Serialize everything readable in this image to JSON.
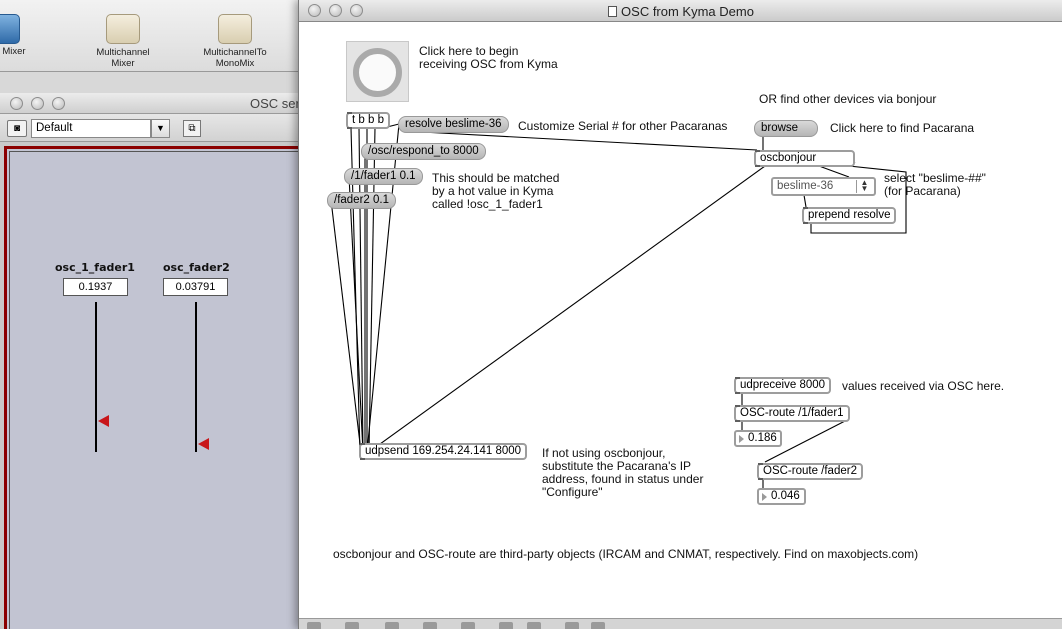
{
  "kyma_toolbar": {
    "items": [
      {
        "label": "Mixer",
        "icon": "mixer-icon"
      },
      {
        "label": "Multichannel\nMixer",
        "icon": "multichannel-mixer-icon"
      },
      {
        "label": "MultichannelTo\nMonoMix",
        "icon": "multichannel-to-mono-icon"
      }
    ]
  },
  "osc_window": {
    "title": "OSC ser",
    "preset": "Default",
    "faders": [
      {
        "label": "osc_1_fader1",
        "value": "0.1937",
        "level": 0.1937
      },
      {
        "label": "osc_fader2",
        "value": "0.03791",
        "level": 0.03791
      }
    ],
    "colors": {
      "frame": "#8b0000",
      "background": "#c2c4d2",
      "thumb": "#c8161a"
    }
  },
  "max_window": {
    "title": "OSC from Kyma Demo",
    "objects": {
      "trigger": "t b b b",
      "resolve_msg": "resolve beslime-36",
      "respond_msg": "/osc/respond_to 8000",
      "fader1_msg": "/1/fader1 0.1",
      "fader2_msg": "/fader2 0.1",
      "browse_msg": "browse",
      "oscbonjour": "oscbonjour",
      "umenu": "beslime-36",
      "prepend": "prepend resolve",
      "udpsend": "udpsend 169.254.24.141 8000",
      "udpreceive": "udpreceive 8000",
      "route1": "OSC-route /1/fader1",
      "num1": "0.186",
      "route2": "OSC-route /fader2",
      "num2": "0.046"
    },
    "comments": {
      "begin": "Click here to begin\nreceiving OSC from Kyma",
      "bonjour": "OR find other devices via bonjour",
      "customize": "Customize Serial # for other Pacaranas",
      "find": "Click here to find Pacarana",
      "select": "select \"beslime-##\"\n(for Pacarana)",
      "hot_value": "This should be matched\nby a hot value in Kyma\ncalled !osc_1_fader1",
      "received": "values received via OSC here.",
      "substitute": "If not using oscbonjour,\nsubstitute the Pacarana's IP\naddress, found in status under\n\"Configure\"",
      "footer": "oscbonjour and OSC-route are third-party objects (IRCAM and CNMAT, respectively. Find on maxobjects.com)"
    }
  }
}
